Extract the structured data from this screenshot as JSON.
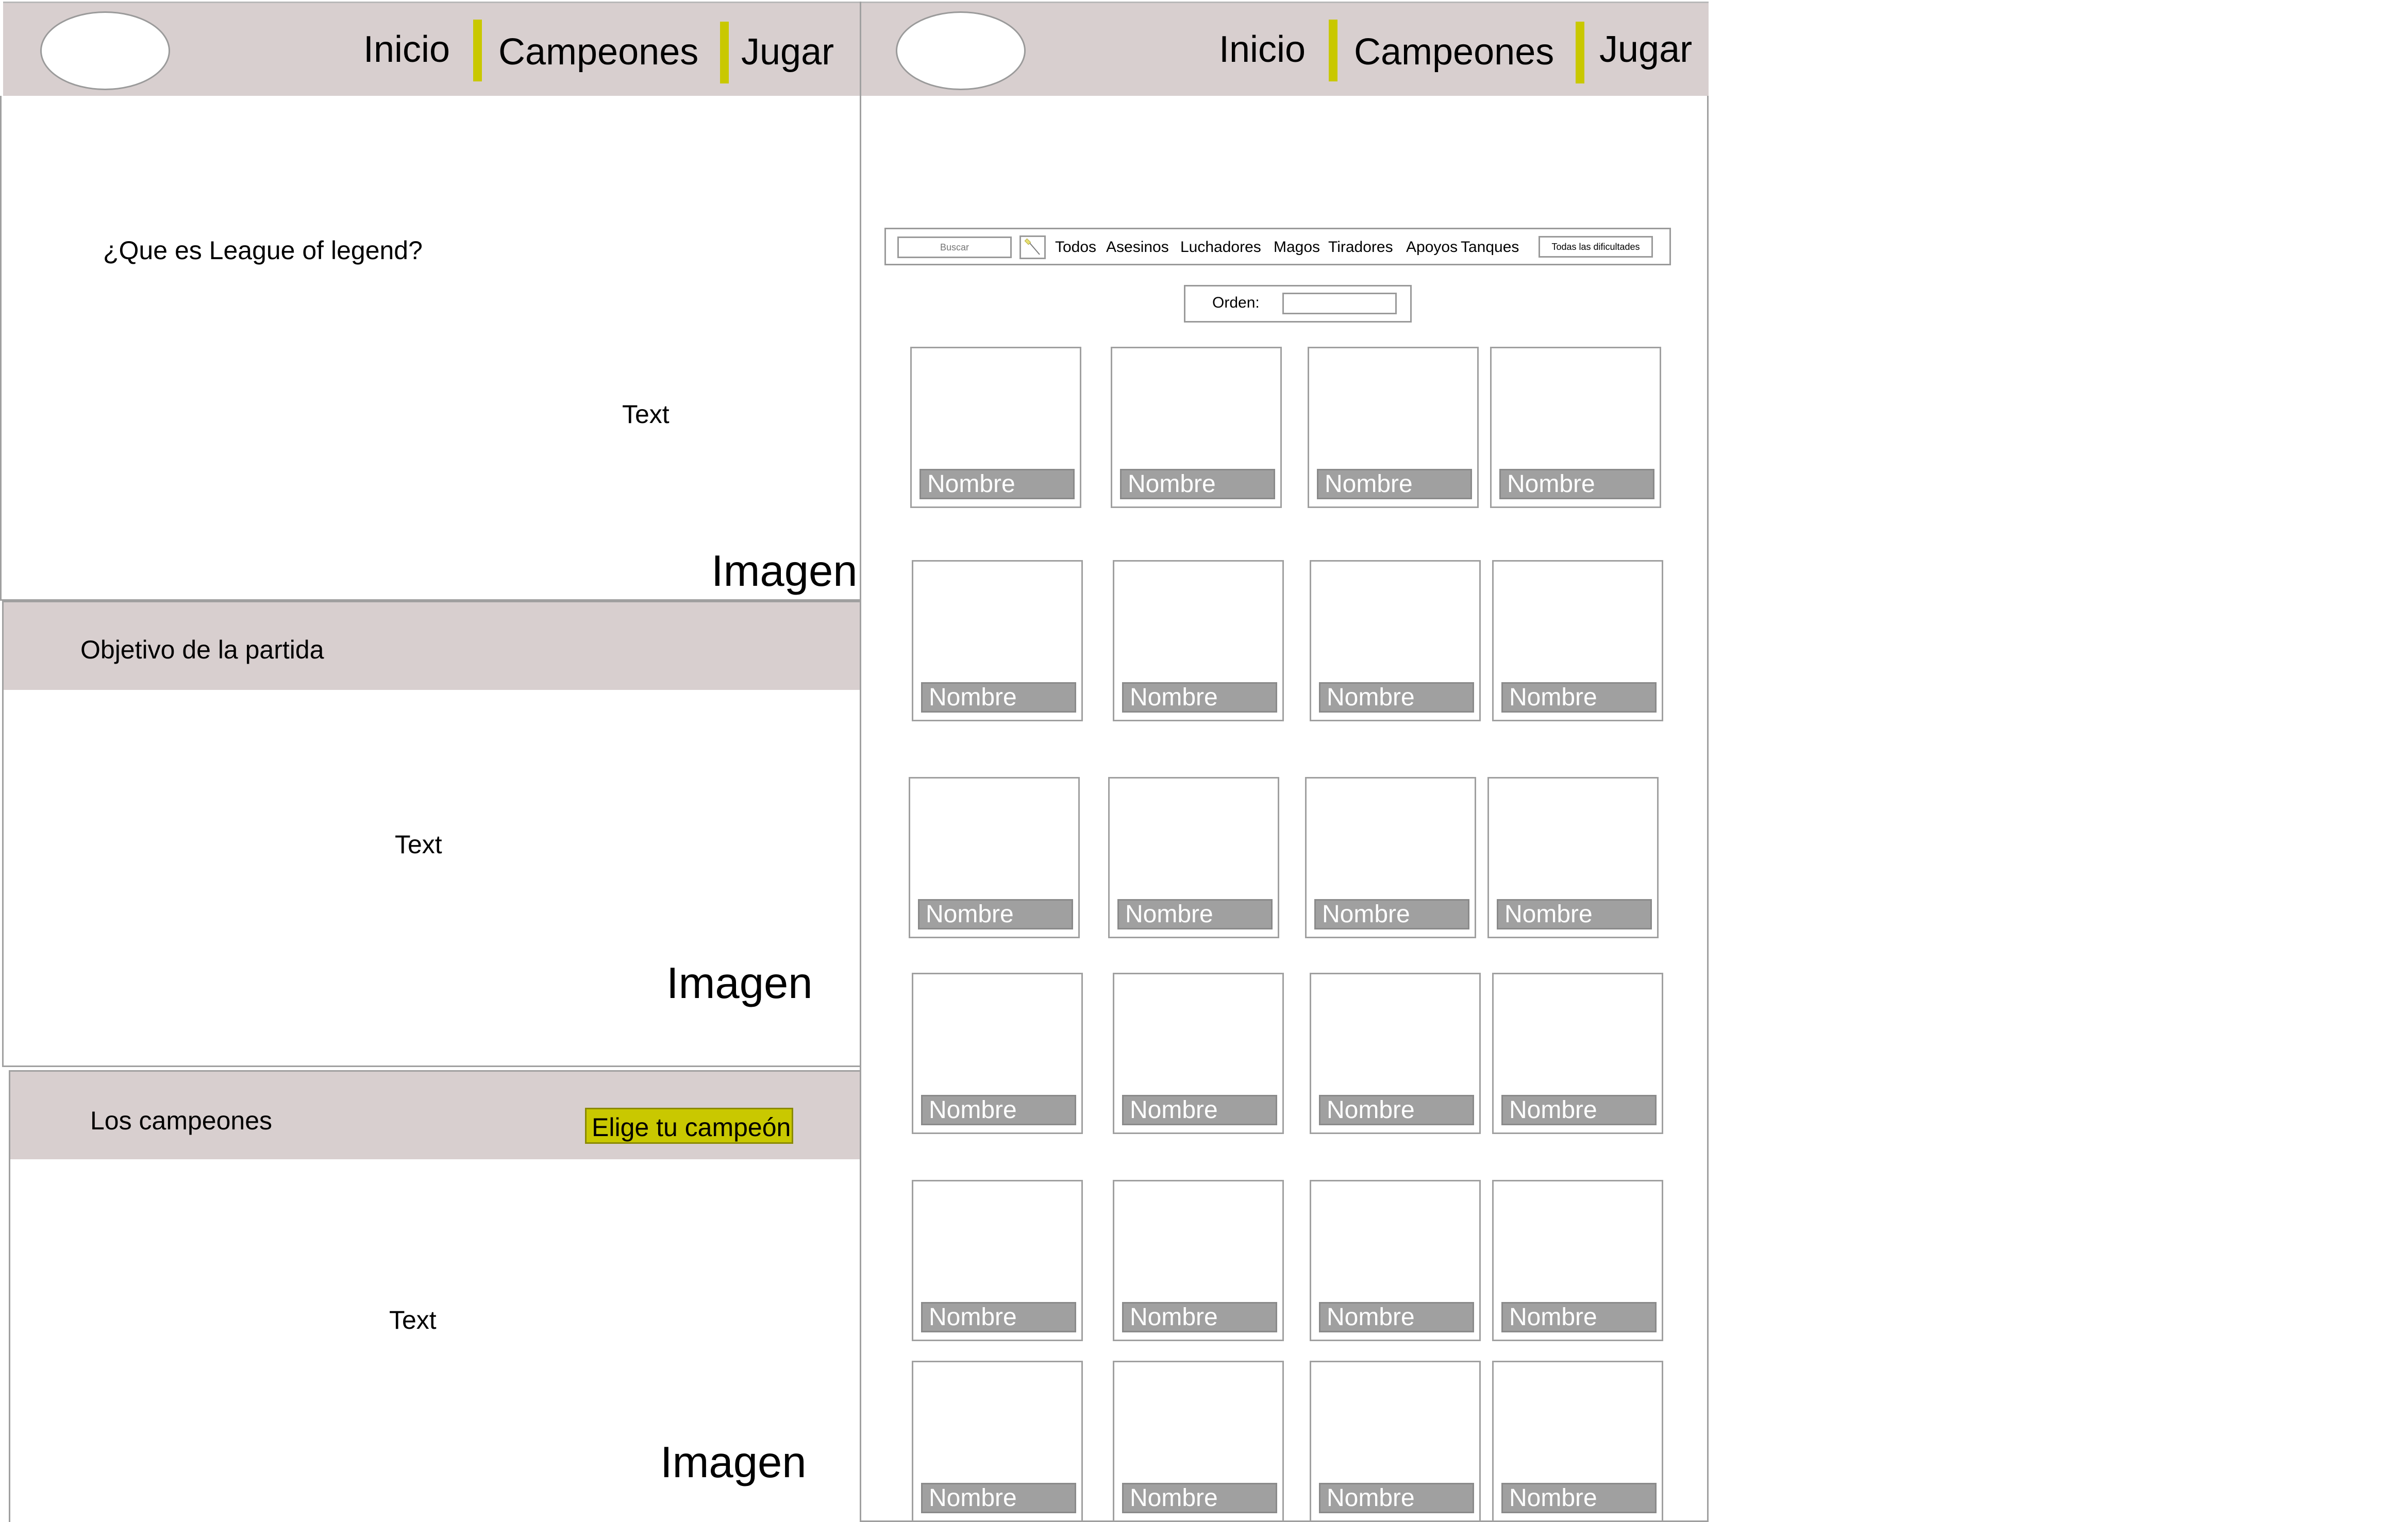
{
  "nav": {
    "items": [
      "Inicio",
      "Campeones",
      "Jugar"
    ]
  },
  "home": {
    "section1": {
      "title": "¿Que es League of legend?",
      "text": "Text",
      "image": "Imagen"
    },
    "section2": {
      "title": "Objetivo de la partida",
      "text": "Text",
      "image": "Imagen"
    },
    "section3": {
      "title": "Los campeones",
      "button": "Elige tu campeón",
      "text": "Text",
      "image": "Imagen"
    }
  },
  "champions_page": {
    "search_placeholder": "Buscar",
    "filters": [
      "Todos",
      "Asesinos",
      "Luchadores",
      "Magos",
      "Tiradores",
      "Apoyos",
      "Tanques"
    ],
    "difficulty": "Todas las dificultades",
    "order_label": "Orden:",
    "cards": [
      [
        "Nombre",
        "Nombre",
        "Nombre",
        "Nombre"
      ],
      [
        "Nombre",
        "Nombre",
        "Nombre",
        "Nombre"
      ],
      [
        "Nombre",
        "Nombre",
        "Nombre",
        "Nombre"
      ],
      [
        "Nombre",
        "Nombre",
        "Nombre",
        "Nombre"
      ],
      [
        "Nombre",
        "Nombre",
        "Nombre",
        "Nombre"
      ],
      [
        "Nombre",
        "Nombre",
        "Nombre",
        "Nombre"
      ]
    ]
  },
  "colors": {
    "header_bg": "#d8cfcf",
    "accent": "#c9c800",
    "name_bar": "#a0a0a0"
  }
}
